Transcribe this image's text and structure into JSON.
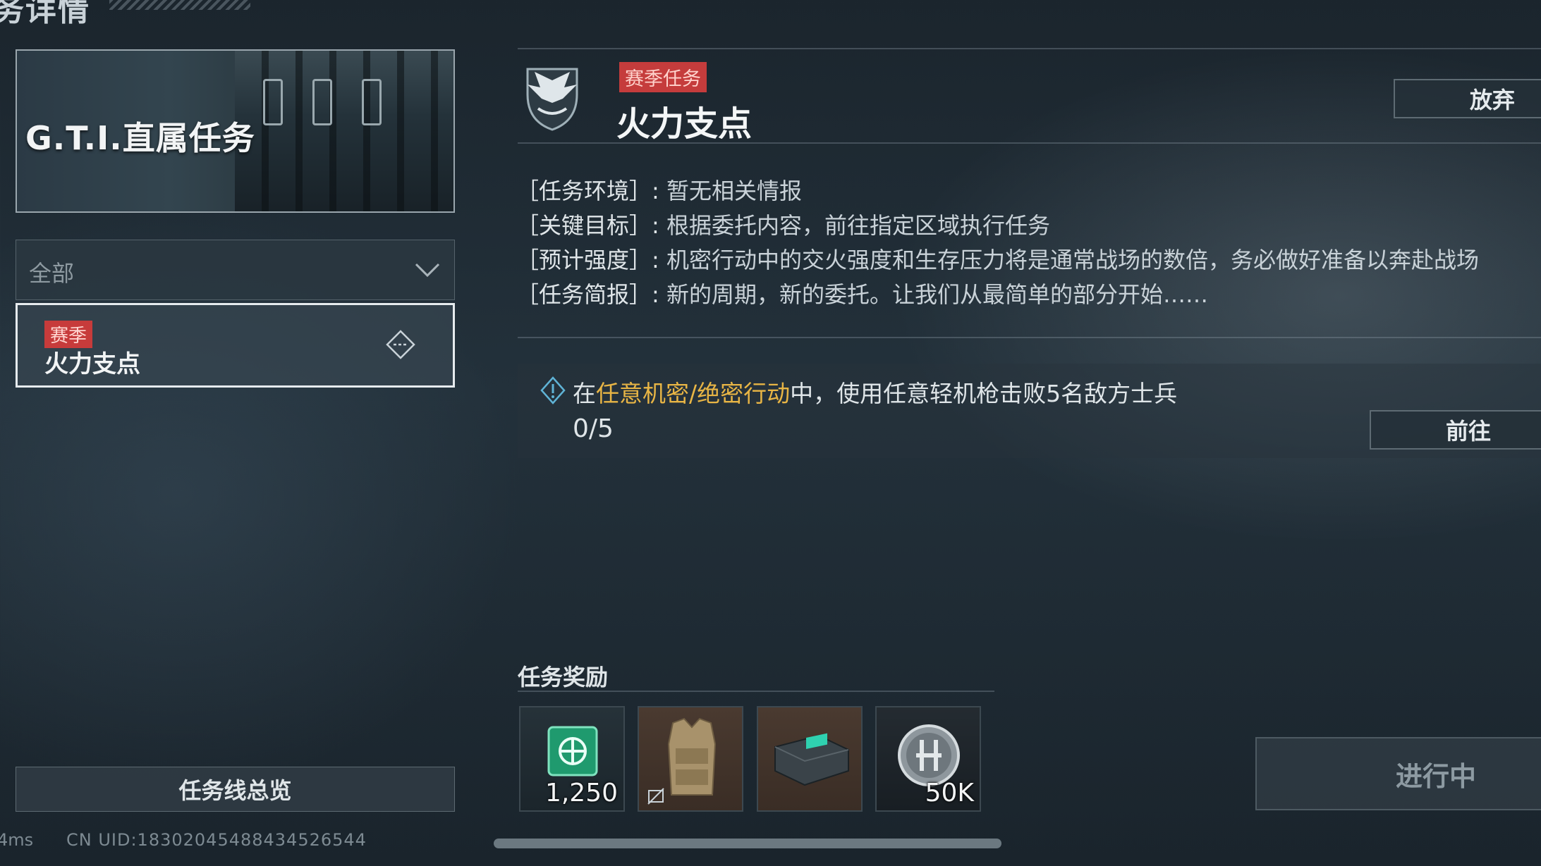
{
  "header": {
    "title": "务详情"
  },
  "left_panel": {
    "banner_title": "G.T.I.直属任务",
    "filter": {
      "selected": "全部"
    },
    "task_list": [
      {
        "tag": "赛季",
        "name": "火力支点"
      }
    ],
    "overview_button": "任务线总览"
  },
  "footer": {
    "ping": "4ms",
    "uid": "CN UID:18302045488434526544"
  },
  "mission": {
    "tag": "赛季任务",
    "title": "火力支点",
    "abandon_button": "放弃",
    "info": [
      {
        "key": "［任务环境］:",
        "value": "暂无相关情报"
      },
      {
        "key": "［关键目标］:",
        "value": "根据委托内容，前往指定区域执行任务"
      },
      {
        "key": "［预计强度］:",
        "value": "机密行动中的交火强度和生存压力将是通常战场的数倍，务必做好准备以奔赴战场"
      },
      {
        "key": "［任务简报］:",
        "value": "新的周期，新的委托。让我们从最简单的部分开始……"
      }
    ],
    "objective": {
      "prefix": "在",
      "highlight": "任意机密/绝密行动",
      "suffix": "中，使用任意轻机枪击败5名敌方士兵",
      "progress": "0/5",
      "goto_button": "前往"
    },
    "rewards_title": "任务奖励",
    "rewards": [
      {
        "icon": "hangar-ticket-icon",
        "qty": "1,250"
      },
      {
        "icon": "body-armor-icon",
        "qty": ""
      },
      {
        "icon": "ammo-case-icon",
        "qty": ""
      },
      {
        "icon": "coin-icon",
        "qty": "50K"
      }
    ],
    "status_button": "进行中"
  },
  "colors": {
    "tag_red": "#c53c3c",
    "highlight_gold": "#e8b545",
    "background": "#1f2b33"
  }
}
